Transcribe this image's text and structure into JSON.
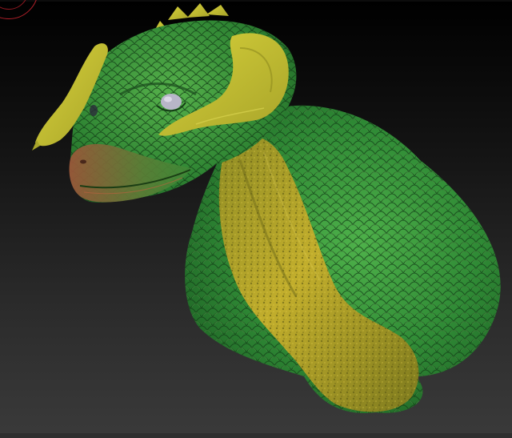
{
  "viewport": {
    "background_top": "#000000",
    "background_bottom": "#3a3a3a"
  },
  "model": {
    "scale_color": "#3f9a38",
    "belly_color": "#b8a52a",
    "accent_color": "#c8c233",
    "eye_color": "#b8b6c8"
  },
  "icons": {
    "gizmo": "rotation-gizmo-icon"
  }
}
